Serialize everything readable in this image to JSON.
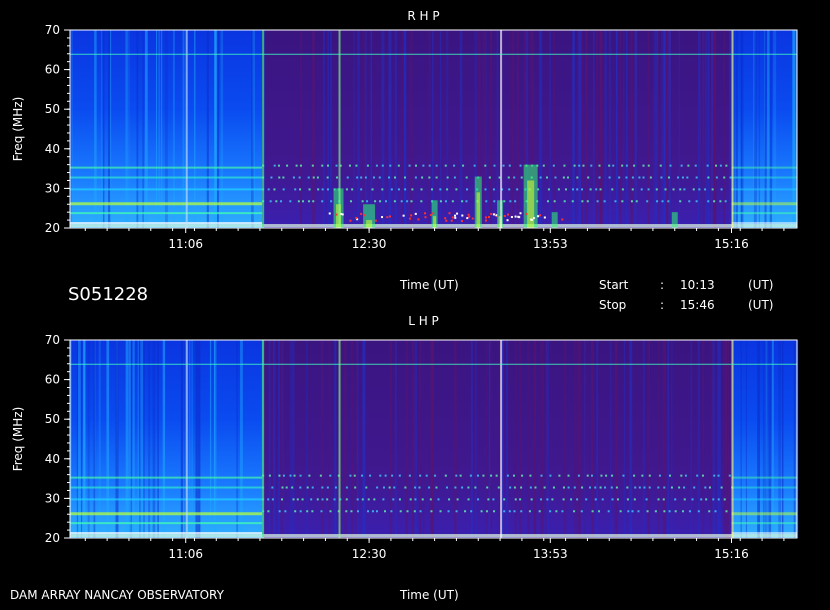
{
  "chart_data": [
    {
      "type": "heatmap",
      "title": "R H P",
      "ylabel": "Freq (MHz)",
      "xlabel": "Time (UT)",
      "ylim": [
        20,
        70
      ],
      "yticks": [
        20,
        30,
        40,
        50,
        60,
        70
      ],
      "xlim": [
        "10:13",
        "15:46"
      ],
      "xticks": [
        "11:06",
        "12:30",
        "13:53",
        "15:16"
      ],
      "observation_window": [
        "11:41",
        "15:16"
      ]
    },
    {
      "type": "heatmap",
      "title": "L H P",
      "ylabel": "Freq (MHz)",
      "xlabel": "Time (UT)",
      "ylim": [
        20,
        70
      ],
      "yticks": [
        20,
        30,
        40,
        50,
        60,
        70
      ],
      "xlim": [
        "10:13",
        "15:46"
      ],
      "xticks": [
        "11:06",
        "12:30",
        "13:53",
        "15:16"
      ],
      "observation_window": [
        "11:41",
        "15:16"
      ]
    }
  ],
  "info": {
    "date_code": "S051228",
    "time_label": "Time (UT)",
    "start_label": "Start",
    "stop_label": "Stop",
    "sep": ":",
    "start_time": "10:13",
    "stop_time": "15:46",
    "unit": "(UT)"
  },
  "footer": {
    "instrument": "DAM ARRAY   NANCAY OBSERVATORY",
    "time_label": "Time (UT)"
  }
}
